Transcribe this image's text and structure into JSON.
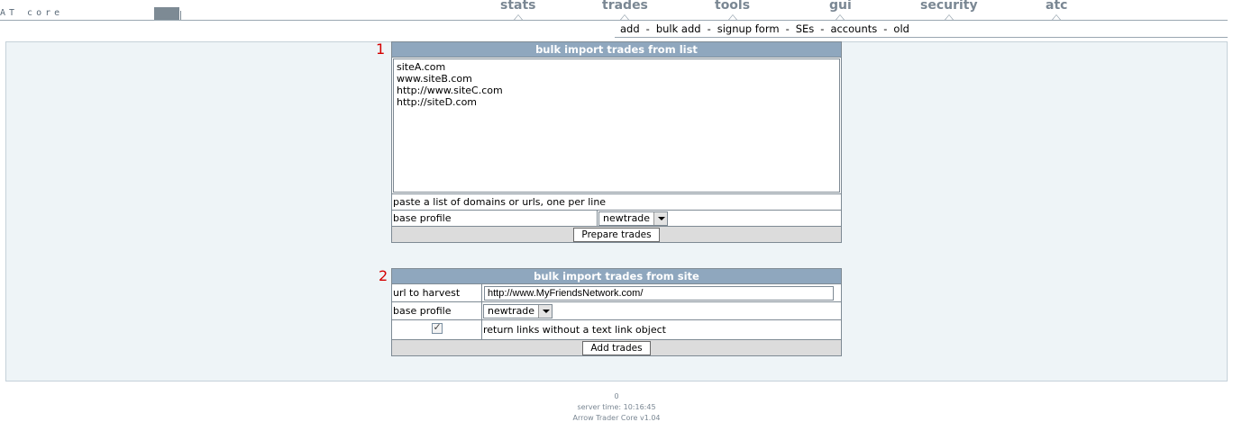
{
  "header": {
    "logo_text": "AT core",
    "nav": [
      {
        "label": "stats"
      },
      {
        "label": "trades"
      },
      {
        "label": "tools"
      },
      {
        "label": "gui"
      },
      {
        "label": "security"
      },
      {
        "label": "atc"
      }
    ],
    "subnav": [
      "add",
      "bulk add",
      "signup form",
      "SEs",
      "accounts",
      "old"
    ],
    "subnav_separator": "-"
  },
  "section1": {
    "number": "1",
    "title": "bulk import trades from list",
    "textarea_value": "siteA.com\nwww.siteB.com\nhttp://www.siteC.com\nhttp://siteD.com",
    "hint": "paste a list of domains or urls, one per line",
    "base_profile_label": "base profile",
    "base_profile_value": "newtrade",
    "button_label": "Prepare trades"
  },
  "section2": {
    "number": "2",
    "title": "bulk import trades from site",
    "url_label": "url to harvest",
    "url_value": "http://www.MyFriendsNetwork.com/",
    "base_profile_label": "base profile",
    "base_profile_value": "newtrade",
    "checkbox_checked": true,
    "checkbox_label": "return links without a text link object",
    "button_label": "Add trades"
  },
  "footer": {
    "counter": "0",
    "server_time": "server time: 10:16:45",
    "version": "Arrow Trader Core v1.04"
  },
  "colors": {
    "panel_bg": "#eef4f7",
    "table_header": "#8fa7be",
    "nav_text": "#7a8793",
    "number_red": "#d40000"
  }
}
